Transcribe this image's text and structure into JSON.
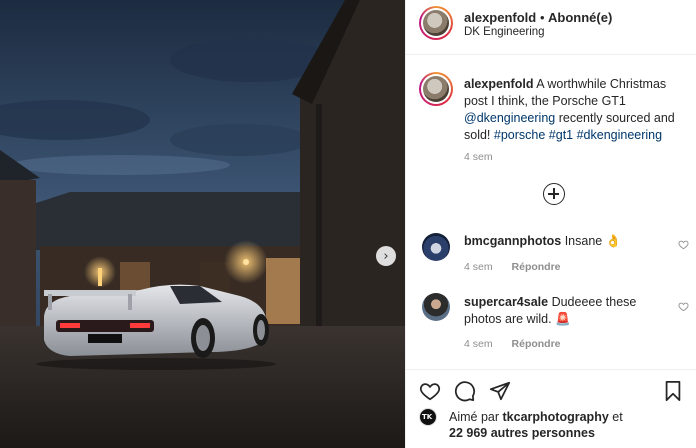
{
  "header": {
    "username": "alexpenfold",
    "separator": "•",
    "follow_status": "Abonné(e)",
    "location": "DK Engineering"
  },
  "caption": {
    "username": "alexpenfold",
    "text_before_mention": " A worthwhile Christmas post I think, the Porsche GT1 ",
    "mention": "@dkengineering",
    "text_after_mention": " recently sourced and sold! ",
    "hashtags": "#porsche #gt1 #dkengineering",
    "time": "4 sem"
  },
  "comments": [
    {
      "username": "bmcgannphotos",
      "text": "Insane 👌",
      "time": "4 sem",
      "reply": "Répondre"
    },
    {
      "username": "supercar4sale",
      "text": "Dudeeee these photos are wild. 🚨",
      "time": "4 sem",
      "reply": "Répondre"
    }
  ],
  "likes": {
    "prefix": "Aimé par",
    "user": "tkcarphotography",
    "connector": "et",
    "others": "22 969 autres personnes"
  },
  "icons": {
    "like": "heart-icon",
    "comment": "comment-bubble-icon",
    "share": "paper-plane-icon",
    "save": "bookmark-icon",
    "next": "chevron-right-icon",
    "load_more": "plus-circle-icon"
  },
  "colors": {
    "link": "#00376b",
    "muted": "#8e8e8e",
    "text": "#262626",
    "border": "#efefef"
  }
}
